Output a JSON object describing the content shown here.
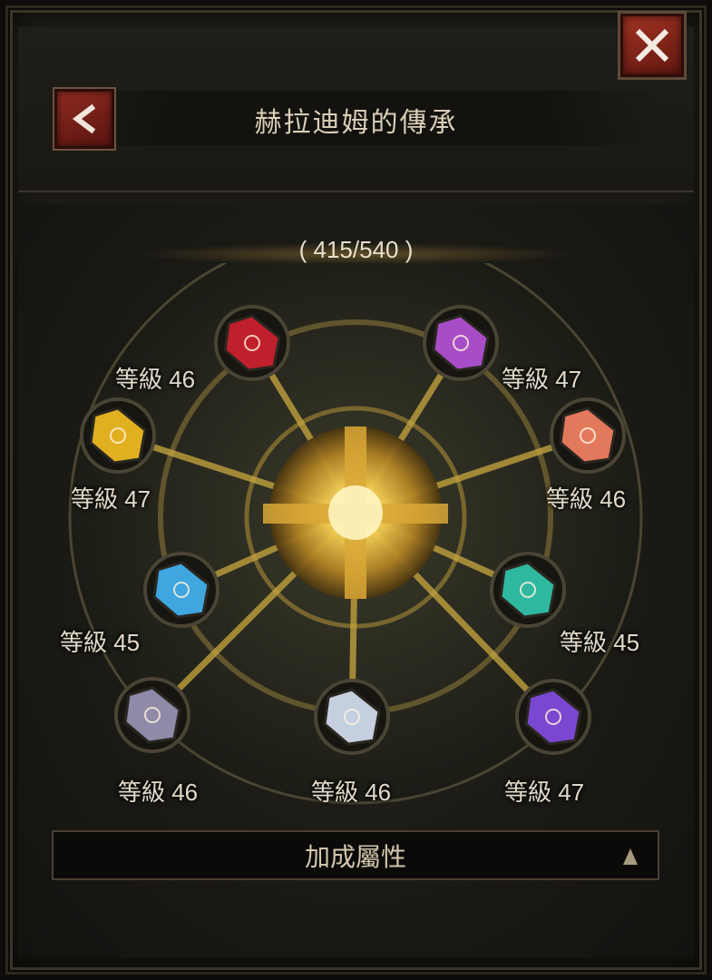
{
  "header": {
    "title": "赫拉迪姆的傳承"
  },
  "progress": {
    "text": "( 415/540 )",
    "current": 415,
    "max": 540
  },
  "icons": {
    "back": "chevron-left-icon",
    "close": "close-x-icon",
    "expand": "triangle-up-icon"
  },
  "gems": [
    {
      "id": "red",
      "level_text": "等級 46",
      "color": "#c0202c"
    },
    {
      "id": "purple",
      "level_text": "等級 47",
      "color": "#a84dc8"
    },
    {
      "id": "yellow",
      "level_text": "等級 47",
      "color": "#e0b020"
    },
    {
      "id": "orange",
      "level_text": "等級 46",
      "color": "#e2785c"
    },
    {
      "id": "blue",
      "level_text": "等級 45",
      "color": "#3fa6e0"
    },
    {
      "id": "teal",
      "level_text": "等級 45",
      "color": "#2fb8a0"
    },
    {
      "id": "gray",
      "level_text": "等級 46",
      "color": "#8f8aa8"
    },
    {
      "id": "white",
      "level_text": "等級 46",
      "color": "#c6cfe0"
    },
    {
      "id": "violet",
      "level_text": "等級 47",
      "color": "#7a48d0"
    }
  ],
  "bonus": {
    "label": "加成屬性"
  }
}
